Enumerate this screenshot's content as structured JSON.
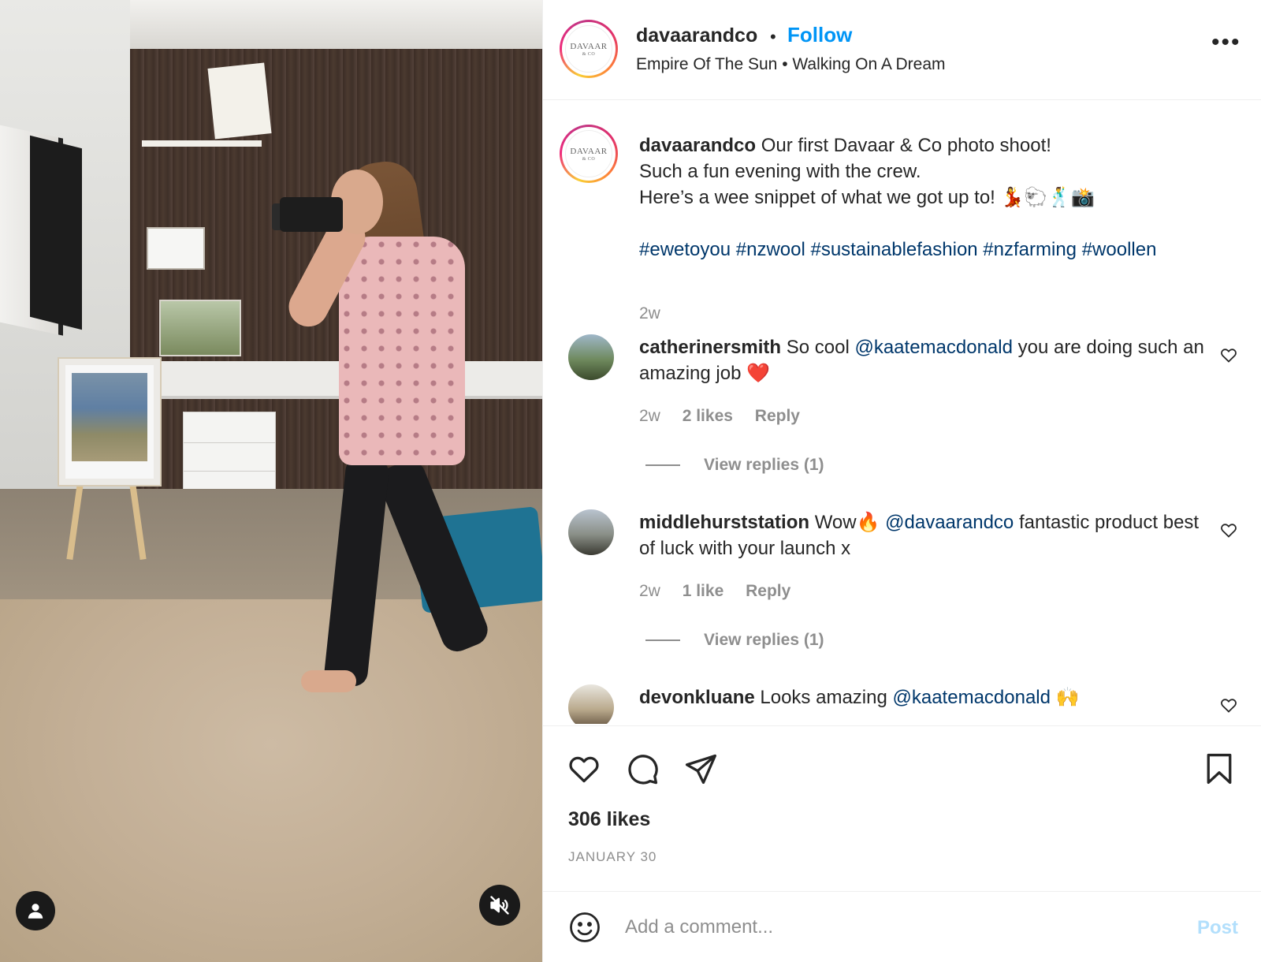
{
  "post": {
    "username": "davaarandco",
    "follow_label": "Follow",
    "separator": "•",
    "music": "Empire Of The Sun • Walking On A Dream",
    "more_label": "•••",
    "brand_logo_line1": "DAVAAR",
    "brand_logo_line2": "& CO"
  },
  "caption": {
    "username": "davaarandco",
    "line1": "Our first Davaar & Co photo shoot!",
    "line2": "Such a fun evening with the crew.",
    "line3": "Here’s a wee snippet of what we got up to! 💃🐑🕺📸",
    "hashtags": "#ewetoyou #nzwool #sustainablefashion #nzfarming #woollen",
    "age": "2w"
  },
  "comments": [
    {
      "username": "catherinersmith",
      "pre": "So cool",
      "mention": "@kaatemacdonald",
      "post": "you are doing such an amazing job ❤️",
      "age": "2w",
      "likes": "2 likes",
      "reply": "Reply",
      "view_replies": "View replies (1)"
    },
    {
      "username": "middlehurststation",
      "pre": "Wow🔥",
      "mention": "@davaarandco",
      "post": "fantastic product best of luck with your launch x",
      "age": "2w",
      "likes": "1 like",
      "reply": "Reply",
      "view_replies": "View replies (1)"
    },
    {
      "username": "devonkluane",
      "pre": "Looks amazing",
      "mention": "@kaatemacdonald",
      "post": "🙌"
    }
  ],
  "stats": {
    "likes": "306 likes",
    "date": "JANUARY 30"
  },
  "add_comment": {
    "placeholder": "Add a comment...",
    "post_label": "Post"
  },
  "colors": {
    "link": "#0095f6",
    "mention": "#00376b",
    "muted": "#8e8e8e",
    "post_disabled": "#b2dffc"
  }
}
